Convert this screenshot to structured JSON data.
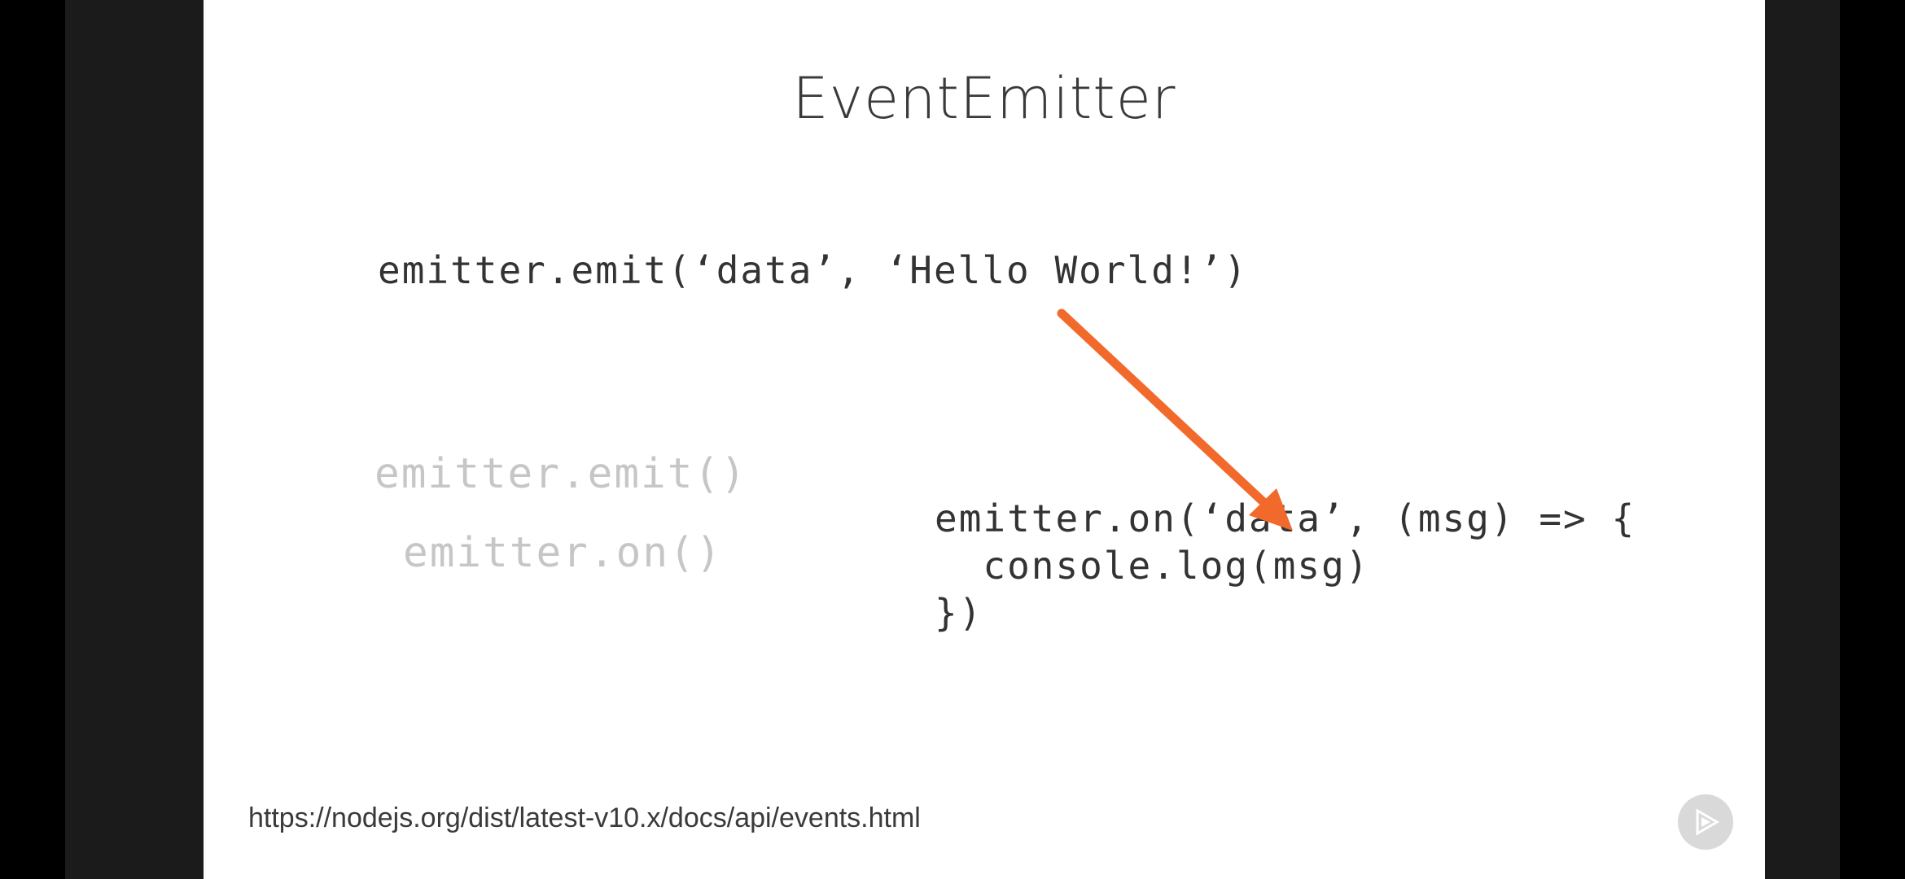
{
  "slide": {
    "title": "EventEmitter",
    "emit_example": "emitter.emit(‘data’, ‘Hello World!’)",
    "method_list": [
      "emitter.emit()",
      "emitter.on()"
    ],
    "on_example": "emitter.on(‘data’, (msg) => {\n  console.log(msg)\n})",
    "url": "https://nodejs.org/dist/latest-v10.x/docs/api/events.html"
  },
  "annotations": {
    "arrow_color": "#f26a2b",
    "arrow_icon": "arrow-icon"
  },
  "player": {
    "badge_icon": "play-logo-icon"
  }
}
